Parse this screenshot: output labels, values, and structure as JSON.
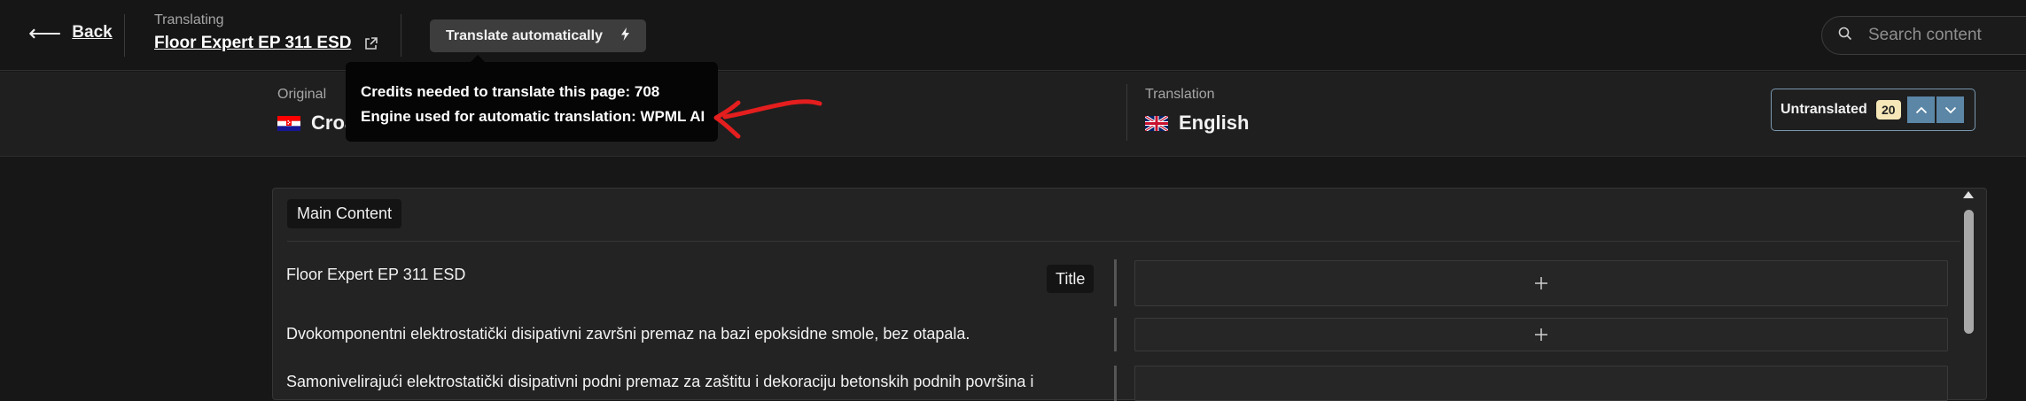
{
  "header": {
    "back_label": "Back",
    "translating_label": "Translating",
    "page_title": "Floor Expert EP 311 ESD",
    "translate_auto_label": "Translate automatically",
    "search_placeholder": "Search content"
  },
  "tooltip": {
    "credits_line": "Credits needed to translate this page: 708",
    "engine_line": "Engine used for automatic translation: WPML AI"
  },
  "languages": {
    "original_label": "Original",
    "original_name": "Croatian",
    "translation_label": "Translation",
    "translation_name": "English"
  },
  "filter": {
    "label": "Untranslated",
    "count": "20"
  },
  "content": {
    "section_title": "Main Content",
    "rows": [
      {
        "source": "Floor Expert EP 311 ESD",
        "type": "Title"
      },
      {
        "source": "Dvokomponentni elektrostatički disipativni završni premaz na bazi epoksidne smole, bez otapala."
      },
      {
        "source": "Samonivelirajući elektrostatički disipativni podni premaz za zaštitu i dekoraciju betonskih podnih površina i"
      }
    ]
  },
  "colors": {
    "accent_nav": "#5b86a6",
    "annotation_red": "#e41e1e",
    "badge_bg": "#f5e7b8"
  },
  "icons": {
    "back": "arrow-left-icon",
    "external": "external-link-icon",
    "bolt": "lightning-icon",
    "search": "search-icon",
    "add": "plus-icon",
    "prev": "chevron-up-icon",
    "next": "chevron-down-icon"
  }
}
